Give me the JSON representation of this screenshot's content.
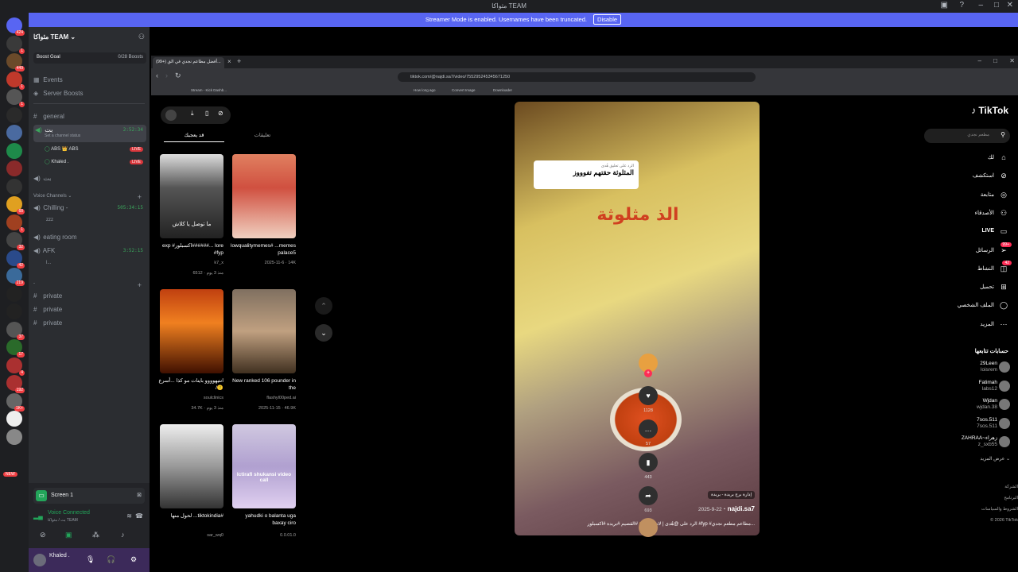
{
  "window": {
    "title": "مثواكا TEAM"
  },
  "banner": {
    "text": "Streamer Mode is enabled. Usernames have been truncated.",
    "disable": "Disable"
  },
  "servers": [
    {
      "badge": "424"
    },
    {
      "badge": "1"
    },
    {
      "badge": "449"
    },
    {
      "badge": "1"
    },
    {
      "badge": "1"
    },
    {
      "badge": ""
    },
    {
      "badge": ""
    },
    {
      "badge": ""
    },
    {
      "badge": ""
    },
    {
      "badge": ""
    },
    {
      "badge": "68"
    },
    {
      "badge": "1"
    },
    {
      "badge": "32"
    },
    {
      "badge": "42"
    },
    {
      "badge": "219"
    },
    {
      "badge": ""
    },
    {
      "badge": ""
    },
    {
      "badge": "37"
    },
    {
      "badge": "17"
    },
    {
      "badge": "4"
    },
    {
      "badge": "192"
    },
    {
      "badge": "1K+"
    },
    {
      "badge": ""
    },
    {
      "badge": ""
    }
  ],
  "server_new_label": "NEW",
  "guild": {
    "name": "مثواكا TEAM",
    "boost_goal": "Boost Goal",
    "boosts": "0/28 Boosts"
  },
  "nav": {
    "events": "Events",
    "server_boosts": "Server Boosts"
  },
  "channels": {
    "general": "general",
    "voice1": {
      "name": "بت",
      "time": "2:52:34",
      "status": "Set a channel status"
    },
    "members": [
      {
        "name": "ABS 👑 ABS",
        "live": "LIVE"
      },
      {
        "name": "Khaled .",
        "live": "LIVE"
      }
    ],
    "voice_header": "Voice Channels",
    "chilling": {
      "name": "Chilling -",
      "time": "505:34:15",
      "member": "zzz"
    },
    "eating": "eating room",
    "afk": {
      "name": "AFK",
      "time": "3:52:15",
      "member": "l..."
    },
    "text2": "بت",
    "dash": "-",
    "private": [
      "private",
      "private",
      "private"
    ]
  },
  "panel": {
    "screen": "Screen 1",
    "voice": "Voice Connected",
    "voice_sub": "بت / مثواكا TEAM",
    "user": "Khaled ."
  },
  "browser": {
    "tab_title": "(99+) أفضل مطاعم نجدي في الق...",
    "url": "tiktok.com/@najdi.sa7/video/755295245345671250",
    "bookmarks": [
      "Stream - Kick Dashb...",
      "How long ago",
      "Convert Image",
      "Downloader"
    ]
  },
  "tiktok": {
    "logo": "TikTok",
    "search_placeholder": "مطعم نجدي",
    "tabs": {
      "comments": "تعليقات",
      "you_may_like": "قد يعجبك"
    },
    "videos": [
      {
        "overlay": "ما توصل يا كلاش",
        "caption": "exp #اكسبلور######... lore #fyp",
        "user": "k7_x",
        "likes": "6512",
        "date": "منذ 3 يوم"
      },
      {
        "overlay": "",
        "caption": "lowqualitymemes# ...memes palace5",
        "user": "",
        "likes": "14K",
        "date": "2025-11-6"
      },
      {
        "overlay": "",
        "caption": "انتيهوووو باينات مو كذا ...أسرع /🙂",
        "user": "soulclinics",
        "likes": "34.7K",
        "date": "منذ 3 يوم"
      },
      {
        "overlay": "",
        "caption": "New ranked 106 pounder in the",
        "user": "flashyl00ped.ai",
        "likes": "46.9K",
        "date": "2025-11-15"
      },
      {
        "overlay": "",
        "caption": "لحول منها ...tiktokindia#",
        "user": "sar_wq0",
        "likes": "",
        "date": ""
      },
      {
        "overlay": "Ictirafi shukansi video call",
        "caption": "yahudki o balanta uga baxay ciro",
        "user": "0.0.01.0",
        "likes": "",
        "date": ""
      }
    ],
    "main_video": {
      "reply_label": "الرد على تعليق هُدى",
      "reply_text": "المثلوثة حقتهم تفوووز",
      "overlay": "الذ مثلوثة",
      "location": "إدارة برج بريدة - بريدة",
      "author": "najdi.sa7",
      "date": "2025-9-22",
      "caption": "الرد على @هُدى | لاتفوتكم🙌 #القصيم #بريدة #اكسبلور #fyp #مطاعم مطعم نجدي..."
    },
    "actions": {
      "likes": "1128",
      "comments": "57",
      "saves": "443",
      "shares": "693"
    },
    "sidebar_nav": [
      {
        "label": "لك",
        "icon": "home-icon"
      },
      {
        "label": "استكشف",
        "icon": "compass-icon"
      },
      {
        "label": "متابعة",
        "icon": "following-icon"
      },
      {
        "label": "الأصدقاء",
        "icon": "friends-icon"
      },
      {
        "label": "LIVE",
        "icon": "live-icon"
      },
      {
        "label": "الرسائل",
        "icon": "messages-icon",
        "badge": "99+"
      },
      {
        "label": "النشاط",
        "icon": "activity-icon",
        "badge": "42"
      },
      {
        "label": "تحميل",
        "icon": "upload-icon"
      },
      {
        "label": "الملف الشخصي",
        "icon": "profile-icon"
      },
      {
        "label": "المزيد",
        "icon": "more-icon"
      }
    ],
    "following_header": "حسابات تتابعها",
    "following": [
      {
        "name": "29Leen",
        "sub": "loisrem"
      },
      {
        "name": "Fatimah",
        "sub": "labs12"
      },
      {
        "name": "Wjdan",
        "sub": "wjdan.38"
      },
      {
        "name": "7sos.511",
        "sub": "7sos.511"
      },
      {
        "name": "ZAHRAA~زهراء",
        "sub": "z_sxb55"
      }
    ],
    "see_more": "عرض المزيد",
    "footer": [
      "الشركة",
      "البرنامج",
      "الشروط والسياسات",
      "© 2026 TikTok"
    ]
  }
}
